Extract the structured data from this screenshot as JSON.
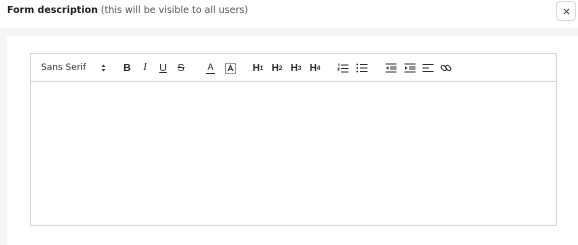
{
  "header": {
    "title_bold": "Form description",
    "title_note": "(this will be visible to all users)"
  },
  "toolbar": {
    "font_family": "Sans Serif",
    "bold_label": "B",
    "italic_label": "I",
    "underline_label": "U",
    "strike_label": "S",
    "font_color_label": "A",
    "headings": [
      {
        "prefix": "H",
        "level": "1"
      },
      {
        "prefix": "H",
        "level": "2"
      },
      {
        "prefix": "H",
        "level": "3"
      },
      {
        "prefix": "H",
        "level": "4"
      }
    ]
  },
  "editor": {
    "content": ""
  }
}
